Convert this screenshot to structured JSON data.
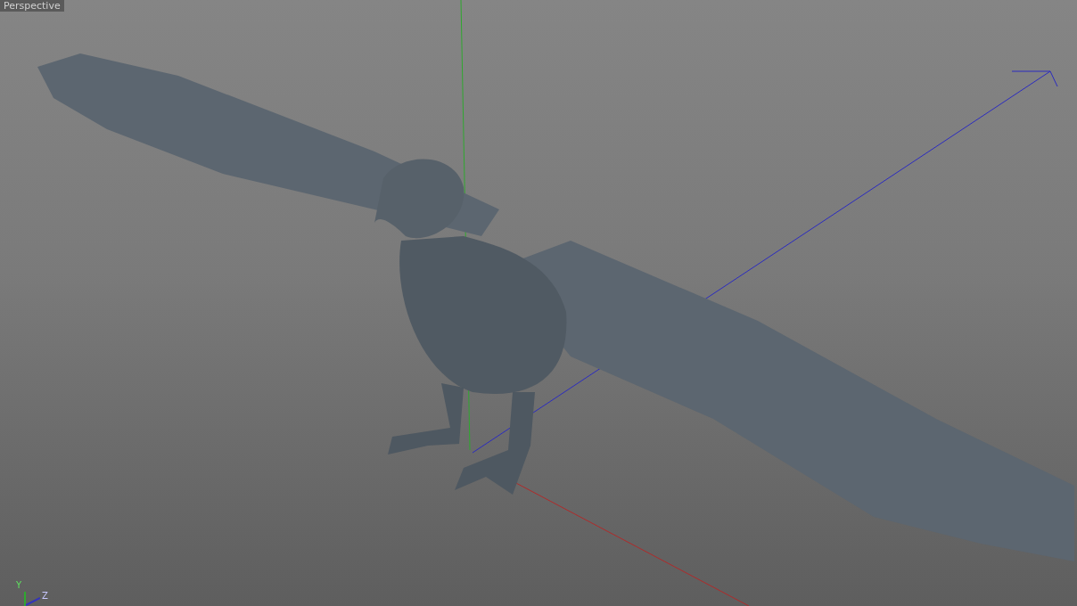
{
  "viewport": {
    "camera_label": "Perspective",
    "axis_labels": [
      "Y",
      "Z"
    ]
  }
}
